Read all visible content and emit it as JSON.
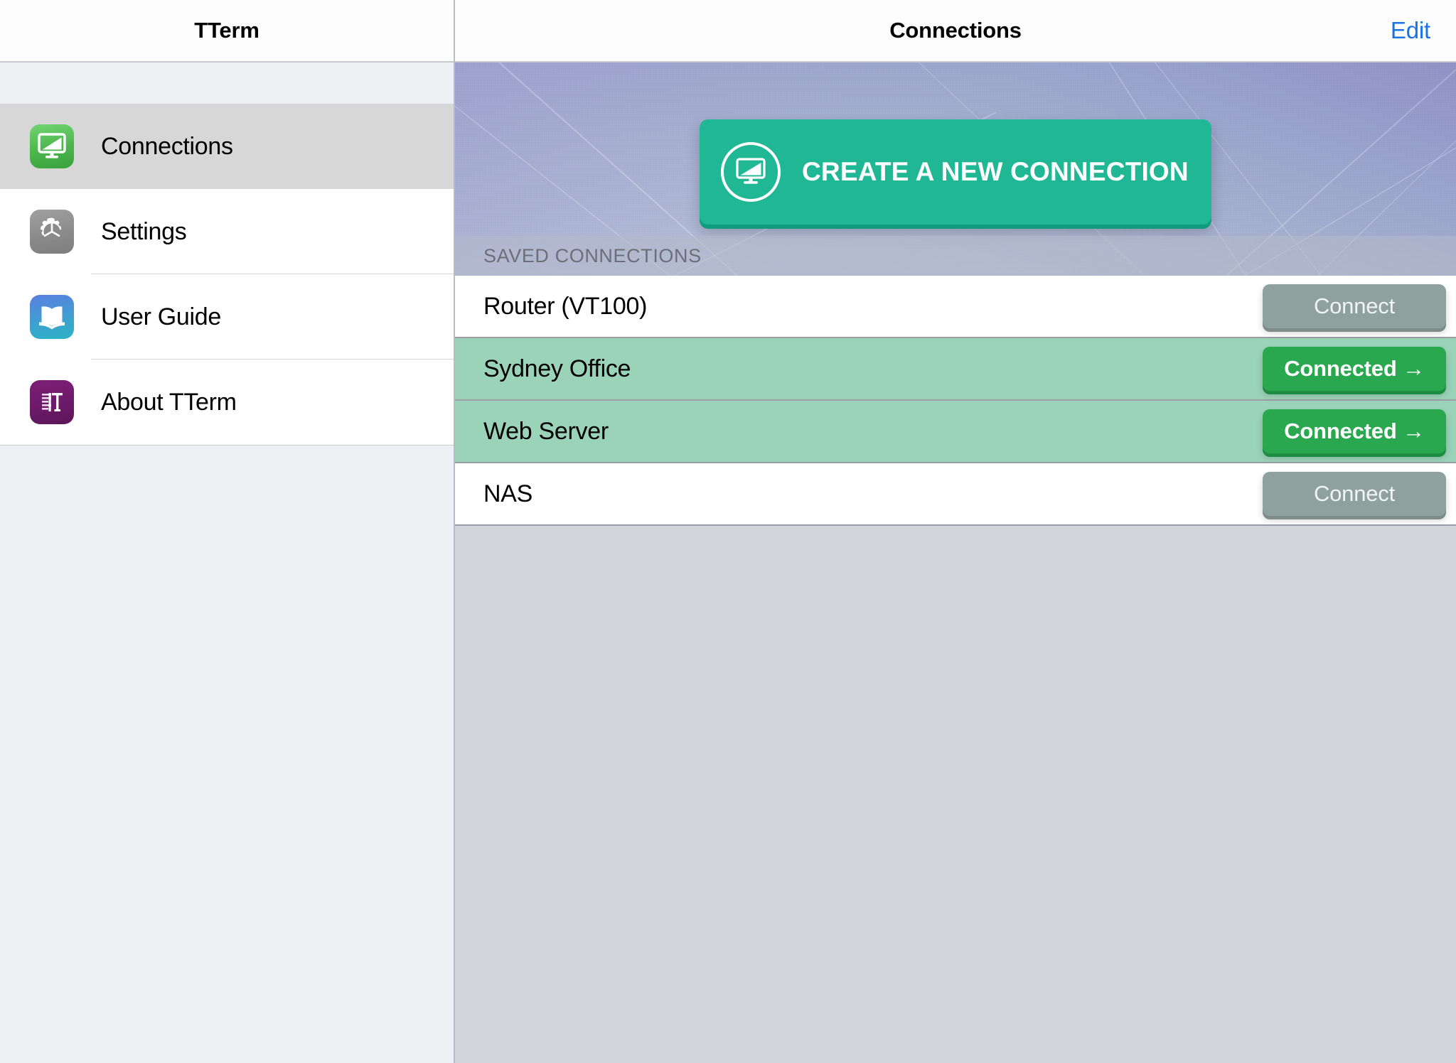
{
  "sidebar": {
    "title": "TTerm",
    "items": [
      {
        "label": "Connections",
        "icon": "monitor-icon",
        "selected": true
      },
      {
        "label": "Settings",
        "icon": "gear-icon",
        "selected": false
      },
      {
        "label": "User Guide",
        "icon": "book-icon",
        "selected": false
      },
      {
        "label": "About TTerm",
        "icon": "tterm-logo-icon",
        "selected": false
      }
    ]
  },
  "detail": {
    "title": "Connections",
    "edit_label": "Edit",
    "create_button_label": "CREATE A NEW CONNECTION",
    "create_button_icon": "monitor-in-circle-icon",
    "section_header": "SAVED CONNECTIONS",
    "connections": [
      {
        "name": "Router (VT100)",
        "action_label": "Connect",
        "connected": false
      },
      {
        "name": "Sydney Office",
        "action_label": "Connected →",
        "connected": true
      },
      {
        "name": "Web Server",
        "action_label": "Connected →",
        "connected": true
      },
      {
        "name": "NAS",
        "action_label": "Connect",
        "connected": false
      }
    ]
  },
  "colors": {
    "accent_teal": "#20b894",
    "connected_green": "#2aa84f",
    "connected_row": "#9ad3b8",
    "idle_button": "#8fa19c",
    "edit_link": "#1b72e8",
    "selected_row": "#d7d7d7"
  }
}
